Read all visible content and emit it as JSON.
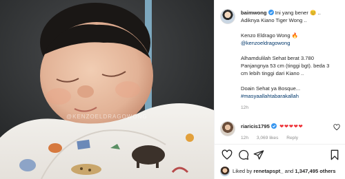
{
  "post": {
    "watermark": "@KENZOELDRAGOWONG"
  },
  "caption": {
    "username": "baimwong",
    "line1": "Ini yang bener 😊 ..",
    "line2": "Adiknya Kiano Tiger Wong ..",
    "line3": "Kenzo Eldrago Wong 🔥",
    "mention": "@kenzoeldragowong",
    "line4": "Alhamdulilah Sehat berat 3.780",
    "line5": "Panjangnya 53 cm (tinggi bgt). beda 3",
    "line6": "cm lebih tinggi dari Kiano ..",
    "line7": "Doain Sehat ya Bosque...",
    "hashtag": "#masyaallahtabarakallah",
    "time": "12h"
  },
  "comment": {
    "username": "riaricis1795",
    "hearts": "❤❤❤❤❤",
    "time": "12h",
    "likes": "3,069 likes",
    "reply": "Reply"
  },
  "likes": {
    "prefix": "Liked by",
    "user": "renetapspt_",
    "and": "and",
    "count": "1,347,495 others"
  },
  "colors": {
    "link": "#00376b",
    "heart": "#ed2d33",
    "muted": "#8e8e8e"
  },
  "icons": {
    "verified": "verified-badge-icon",
    "like": "heart-icon",
    "comment": "comment-icon",
    "share": "share-icon",
    "save": "bookmark-icon"
  }
}
